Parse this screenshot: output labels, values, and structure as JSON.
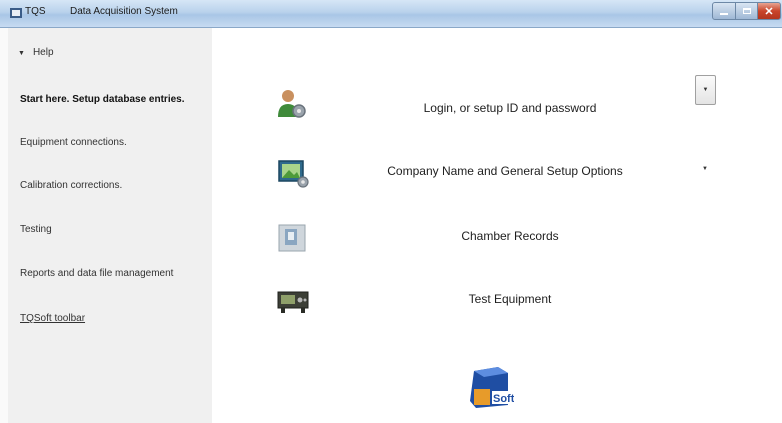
{
  "window": {
    "app_short": "TQS",
    "title": "Data Acquisition System"
  },
  "sidebar": {
    "help": "Help",
    "start": "Start here. Setup database entries.",
    "items": [
      "Equipment connections.",
      "Calibration corrections.",
      "Testing",
      "Reports and data file management",
      "TQSoft toolbar"
    ]
  },
  "main": {
    "rows": [
      {
        "label": "Login, or setup ID and password",
        "icon": "user-gear-icon"
      },
      {
        "label": "Company Name and General Setup Options",
        "icon": "setup-picture-icon"
      },
      {
        "label": "Chamber Records",
        "icon": "chamber-icon"
      },
      {
        "label": "Test Equipment",
        "icon": "test-equipment-icon"
      }
    ],
    "logo_text": "Soft"
  },
  "colors": {
    "titlebar": "#b9d2ec",
    "sidebar": "#f0f0f0",
    "close": "#c9452b",
    "logo_blue": "#1f4ea3",
    "logo_orange": "#e79b2a"
  }
}
